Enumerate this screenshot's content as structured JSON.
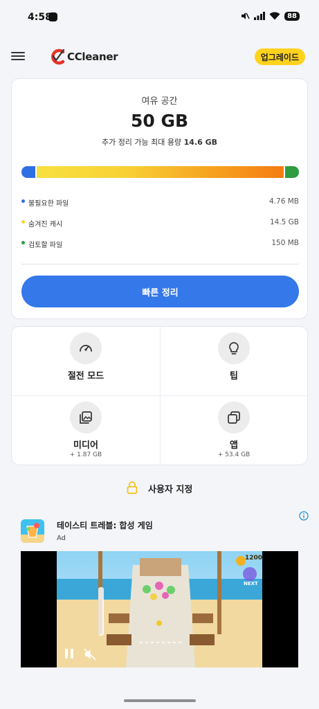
{
  "status_bar": {
    "time": "4:58",
    "battery": "88"
  },
  "app_bar": {
    "brand": "CCleaner",
    "upgrade_label": "업그레이드"
  },
  "storage": {
    "free_label": "여유 공간",
    "free_value": "50 GB",
    "potential_prefix": "추가 정리 가능 최대 용량 ",
    "potential_value": "14.6 GB",
    "usage_bar": {
      "junk_fraction": 0.05,
      "cache_fraction": 0.9,
      "review_fraction": 0.05
    },
    "legend": [
      {
        "label": "불필요한 파일",
        "value": "4.76 MB",
        "color": "#2f6fe4"
      },
      {
        "label": "숨겨진 캐시",
        "value": "14.5 GB",
        "color": "#f5d63a"
      },
      {
        "label": "검토할 파일",
        "value": "150 MB",
        "color": "#2e9c3f"
      }
    ],
    "quick_clean_label": "빠른 정리"
  },
  "tiles": [
    {
      "title": "절전 모드",
      "subtitle": "",
      "icon": "speedometer-icon"
    },
    {
      "title": "팁",
      "subtitle": "",
      "icon": "lightbulb-icon"
    },
    {
      "title": "미디어",
      "subtitle": "+ 1.87 GB",
      "icon": "photos-icon"
    },
    {
      "title": "앱",
      "subtitle": "+ 53.4 GB",
      "icon": "apps-icon"
    }
  ],
  "customize": {
    "label": "사용자 지정"
  },
  "ad": {
    "title": "테이스티 트레블: 합성 게임",
    "tag": "Ad",
    "coin_count": "1200",
    "next_label": "NEXT"
  },
  "colors": {
    "accent": "#3478ea",
    "upgrade": "#ffd21e",
    "background": "#f4f5f8"
  }
}
